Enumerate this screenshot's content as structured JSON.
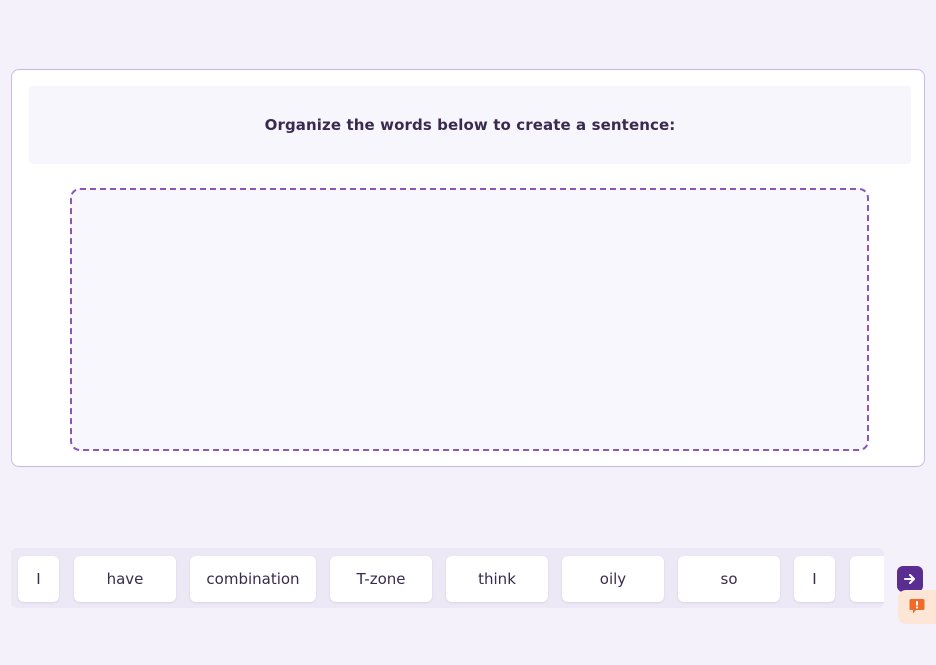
{
  "exercise": {
    "instruction": "Organize the words below to create a sentence:"
  },
  "word_bank": {
    "words": [
      "I",
      "have",
      "combination",
      "T-zone",
      "think",
      "oily",
      "so",
      "I",
      ""
    ]
  },
  "icons": {
    "next": "arrow-right-icon",
    "report": "exclamation-icon"
  },
  "colors": {
    "background": "#f4f1fb",
    "accent": "#5a2e91",
    "drop_zone_border": "#8a57b5",
    "report_background": "#fde6d6",
    "report_icon": "#f06a2a"
  }
}
